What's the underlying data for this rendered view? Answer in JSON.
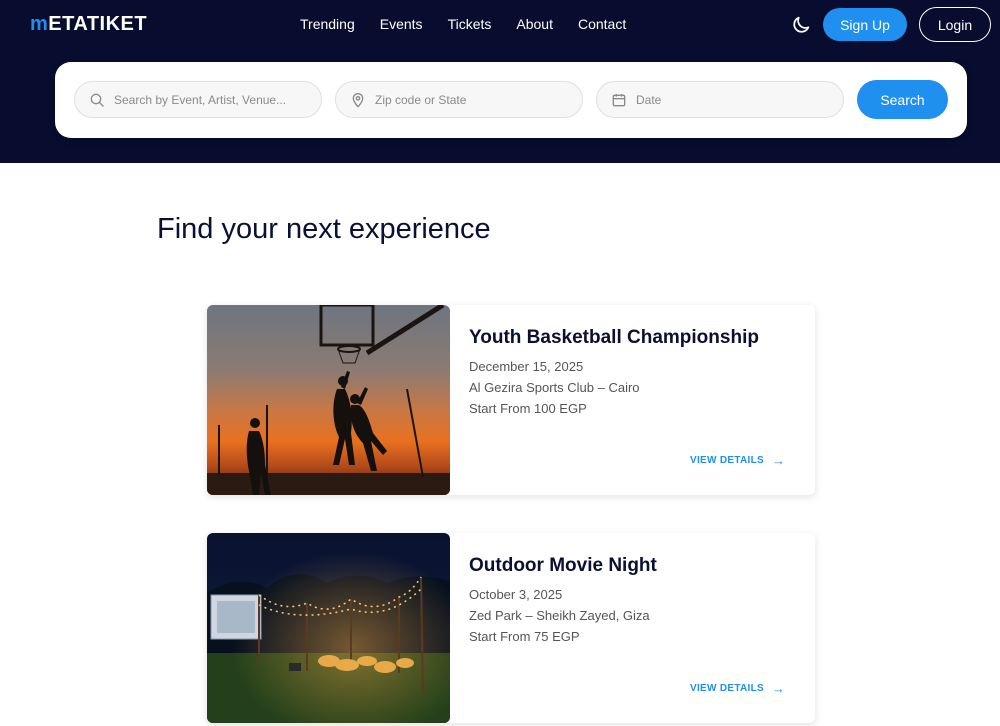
{
  "brand": {
    "prefix": "m",
    "rest": "ETATIKET"
  },
  "nav": {
    "items": [
      "Trending",
      "Events",
      "Tickets",
      "About",
      "Contact"
    ]
  },
  "auth": {
    "signup": "Sign Up",
    "login": "Login"
  },
  "search": {
    "event_placeholder": "Search by Event, Artist, Venue...",
    "location_placeholder": "Zip code or State",
    "date_placeholder": "Date",
    "button": "Search"
  },
  "main": {
    "heading": "Find your next experience"
  },
  "events": [
    {
      "title": "Youth Basketball Championship",
      "date": "December 15, 2025",
      "venue": "Al Gezira Sports Club – Cairo",
      "price": "Start From 100 EGP",
      "cta": "VIEW DETAILS",
      "arrow": "→"
    },
    {
      "title": "Outdoor Movie Night",
      "date": "October 3, 2025",
      "venue": "Zed Park – Sheikh Zayed, Giza",
      "price": "Start From 75 EGP",
      "cta": "VIEW DETAILS",
      "arrow": "→"
    }
  ],
  "colors": {
    "header_bg": "#080c2e",
    "accent": "#1f8ff0",
    "heading": "#0b1033"
  }
}
